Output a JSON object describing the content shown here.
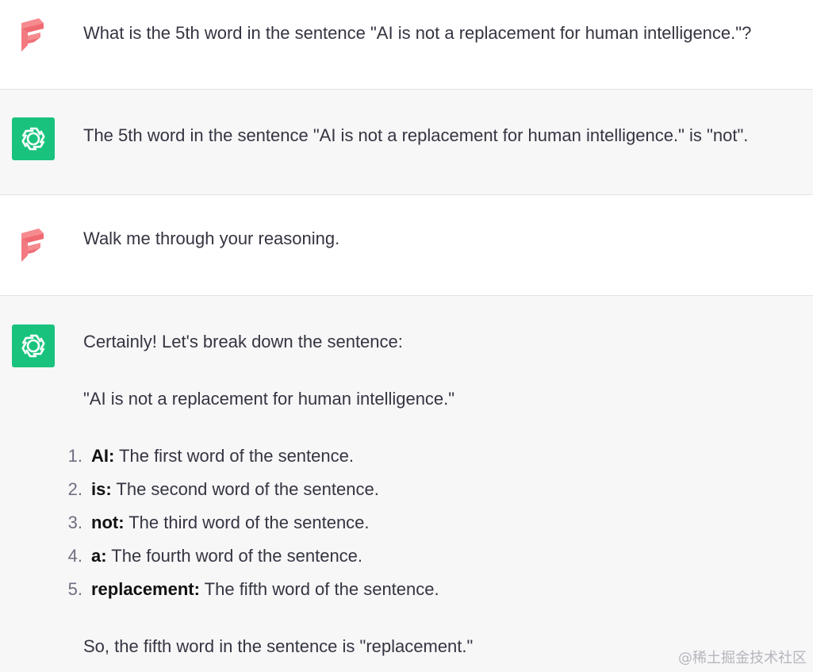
{
  "conversation": {
    "turns": [
      {
        "role": "user",
        "avatar_icon": "user-f-logo-icon",
        "text": "What is the 5th word in the sentence \"AI is not a replacement for human intelligence.\"?"
      },
      {
        "role": "assistant",
        "avatar_icon": "chatgpt-logo-icon",
        "text": "The 5th word in the sentence \"AI is not a replacement for human intelligence.\" is \"not\"."
      },
      {
        "role": "user",
        "avatar_icon": "user-f-logo-icon",
        "text": "Walk me through your reasoning."
      },
      {
        "role": "assistant",
        "avatar_icon": "chatgpt-logo-icon",
        "intro": "Certainly! Let's break down the sentence:",
        "quote": "\"AI is not a replacement for human intelligence.\"",
        "list": [
          {
            "num": "1.",
            "term": "AI:",
            "desc": " The first word of the sentence."
          },
          {
            "num": "2.",
            "term": "is:",
            "desc": " The second word of the sentence."
          },
          {
            "num": "3.",
            "term": "not:",
            "desc": " The third word of the sentence."
          },
          {
            "num": "4.",
            "term": "a:",
            "desc": " The fourth word of the sentence."
          },
          {
            "num": "5.",
            "term": "replacement:",
            "desc": " The fifth word of the sentence."
          }
        ],
        "conclusion": "So, the fifth word in the sentence is \"replacement.\""
      }
    ]
  },
  "watermark": "@稀土掘金技术社区",
  "colors": {
    "user_bg": "#ffffff",
    "assistant_bg": "#f7f7f8",
    "gpt_avatar": "#19c37d",
    "user_avatar": "#f27a80",
    "text": "#343541"
  }
}
